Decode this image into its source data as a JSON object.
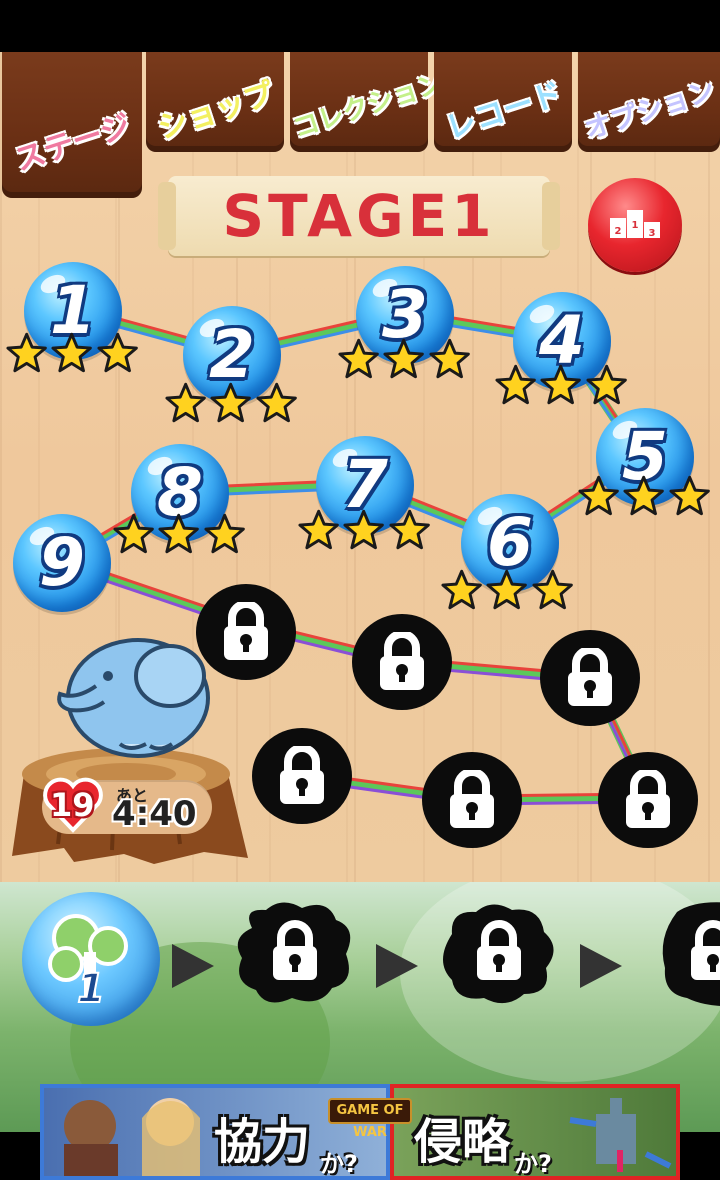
{
  "tabs": [
    {
      "label": "ステージ",
      "color": "#f07aa0",
      "active": true
    },
    {
      "label": "ショップ",
      "color": "#f3f060",
      "active": false
    },
    {
      "label": "コレクション",
      "color": "#c4f08a",
      "active": false
    },
    {
      "label": "レコード",
      "color": "#9ce0ff",
      "active": false
    },
    {
      "label": "オプション",
      "color": "#c4c4ff",
      "active": false
    }
  ],
  "stage": {
    "title": "STAGE1"
  },
  "ranking": {
    "icon": "podium-icon",
    "places": [
      "2",
      "1",
      "3"
    ]
  },
  "levels": [
    {
      "number": "1",
      "stars": 3
    },
    {
      "number": "2",
      "stars": 3
    },
    {
      "number": "3",
      "stars": 3
    },
    {
      "number": "4",
      "stars": 3
    },
    {
      "number": "5",
      "stars": 3
    },
    {
      "number": "6",
      "stars": 3
    },
    {
      "number": "7",
      "stars": 3
    },
    {
      "number": "8",
      "stars": 3
    },
    {
      "number": "9",
      "stars": 0
    }
  ],
  "locked_levels": 6,
  "lives": {
    "count": "19",
    "prefix": "あと",
    "timer": "4:40"
  },
  "worlds": [
    {
      "label": "1",
      "icon": "tree-icon",
      "unlocked": true
    },
    {
      "icon": "lock-icon",
      "unlocked": false
    },
    {
      "icon": "lock-icon",
      "unlocked": false
    },
    {
      "icon": "lock-icon",
      "unlocked": false
    }
  ],
  "ad": {
    "logo": "GAME OF WAR",
    "left_text": "協力",
    "left_suffix": "か?",
    "right_text": "侵略",
    "right_suffix": "か?"
  }
}
